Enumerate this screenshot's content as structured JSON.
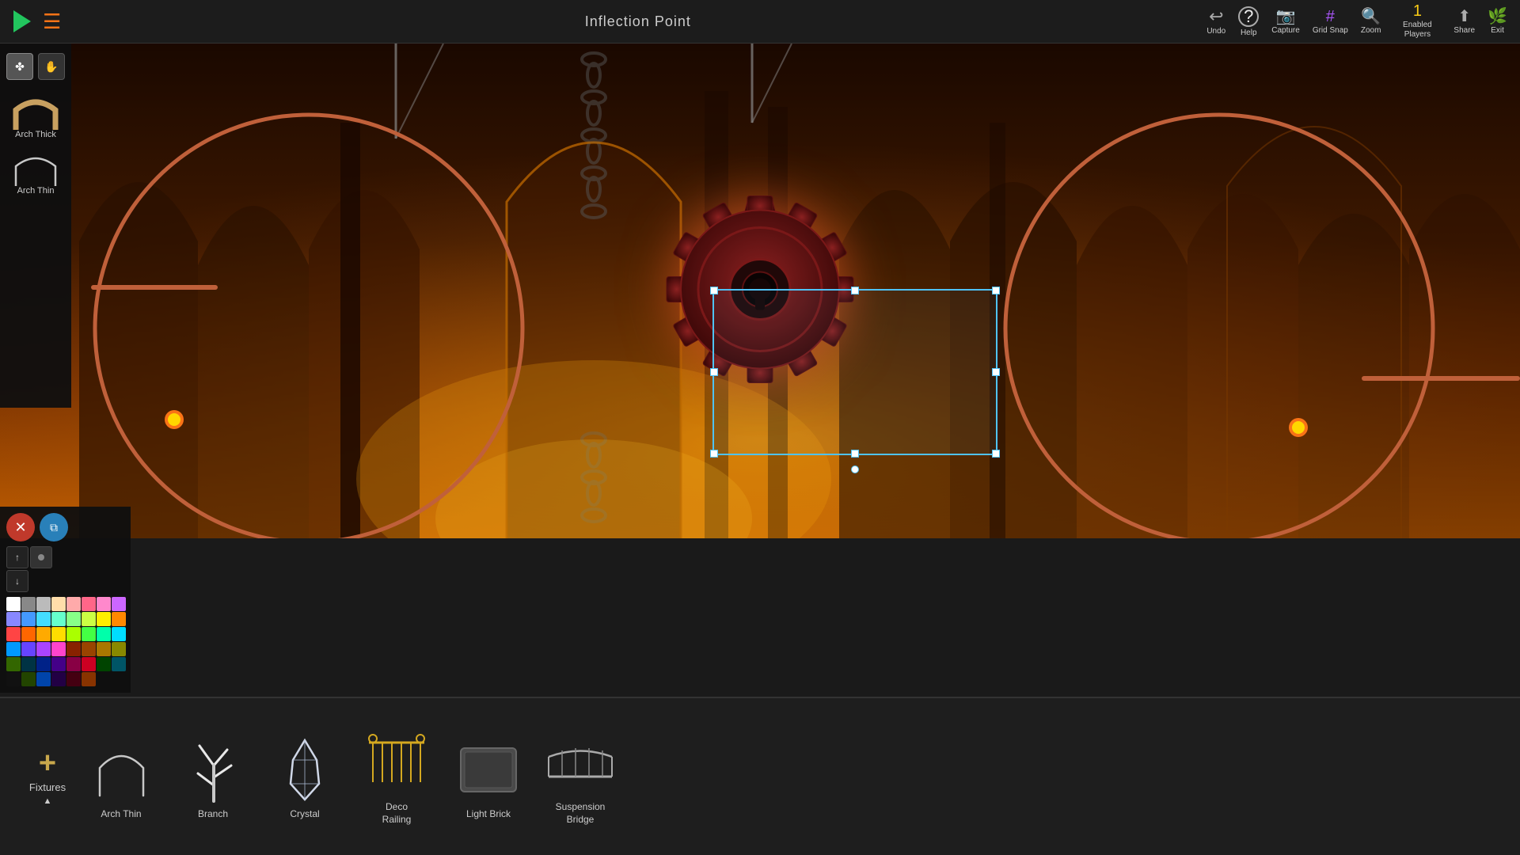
{
  "topbar": {
    "title": "Inflection Point",
    "play_label": "Play",
    "menu_icon": "☰",
    "tools": [
      {
        "name": "undo",
        "label": "Undo",
        "icon": "↩",
        "color": "#aaa"
      },
      {
        "name": "help",
        "label": "Help",
        "icon": "?",
        "color": "#eee"
      },
      {
        "name": "capture",
        "label": "Capture",
        "icon": "📷",
        "color": "#ef4444"
      },
      {
        "name": "grid-snap",
        "label": "Grid Snap",
        "icon": "#",
        "color": "#a855f7"
      },
      {
        "name": "zoom",
        "label": "Zoom",
        "icon": "🔍",
        "color": "#eee"
      },
      {
        "name": "enabled-players",
        "label": "Enabled Players",
        "icon": "1",
        "color": "#facc15"
      },
      {
        "name": "share",
        "label": "Share",
        "icon": "⬆",
        "color": "#aaa"
      },
      {
        "name": "exit",
        "label": "Exit",
        "icon": "🌿",
        "color": "#22c55e"
      }
    ]
  },
  "sidebar": {
    "items": [
      {
        "name": "arch-thick",
        "label": "Arch Thick"
      },
      {
        "name": "arch-thin",
        "label": "Arch Thin"
      }
    ],
    "action_buttons": [
      {
        "name": "delete",
        "icon": "✕",
        "color": "#c0392b"
      },
      {
        "name": "copy",
        "icon": "⧉",
        "color": "#2980b9"
      }
    ]
  },
  "colors": [
    "#ffffff",
    "#888888",
    "#bbbbbb",
    "#ffddaa",
    "#ffaaaa",
    "#ff6688",
    "#ff88cc",
    "#cc66ff",
    "#8888ff",
    "#4499ff",
    "#44ddff",
    "#66ffcc",
    "#88ff88",
    "#ccff44",
    "#ffee00",
    "#ff8800",
    "#ff4444",
    "#ff6600",
    "#ffaa00",
    "#ffdd00",
    "#aaff00",
    "#44ff44",
    "#00ffaa",
    "#00ddff",
    "#0099ff",
    "#6644ff",
    "#aa44ff",
    "#ff44cc",
    "#882200",
    "#994400",
    "#aa7700",
    "#888800",
    "#336600",
    "#003344",
    "#002288",
    "#440088",
    "#880044",
    "#cc0022",
    "#004400",
    "#005566",
    "#111111",
    "#224400",
    "#0044aa",
    "#220044",
    "#440011",
    "#883300"
  ],
  "bottom_panel": {
    "fixtures_label": "Fixtures",
    "add_icon": "+",
    "items": [
      {
        "name": "arch-thin",
        "label": "Arch Thin"
      },
      {
        "name": "branch",
        "label": "Branch"
      },
      {
        "name": "crystal",
        "label": "Crystal"
      },
      {
        "name": "deco-railing",
        "label": "Deco\nRailing"
      },
      {
        "name": "light-brick",
        "label": "Light Brick"
      },
      {
        "name": "suspension-bridge",
        "label": "Suspension\nBridge"
      }
    ]
  }
}
